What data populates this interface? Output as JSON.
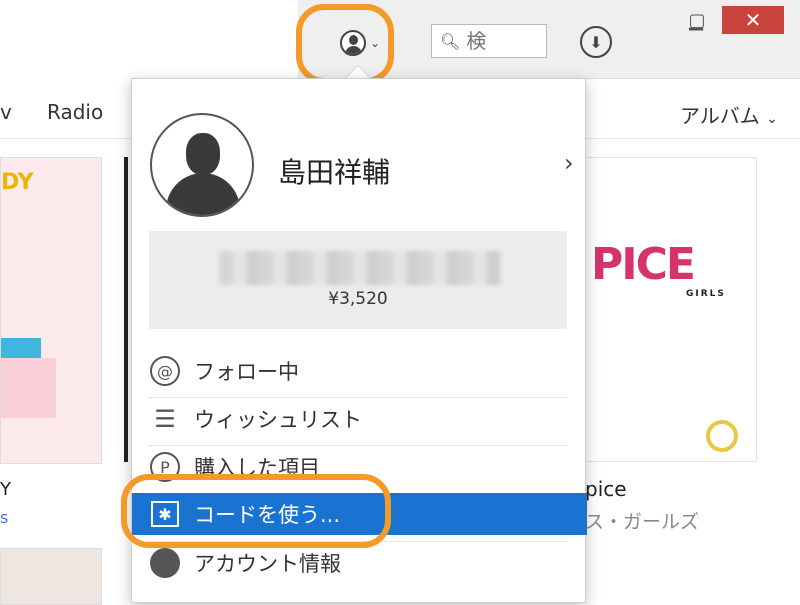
{
  "window": {
    "minimize": "▁",
    "maximize": "▢",
    "close": "✕"
  },
  "header": {
    "account_icon": "account-icon",
    "search_placeholder": "検",
    "download_icon": "download-icon"
  },
  "nav": {
    "items": [
      "v",
      "Radio"
    ],
    "right_label": "アルバム"
  },
  "background": {
    "left_card_title": "DY",
    "left_text": "Y",
    "left_blue": "s",
    "right_art_word": "PICE",
    "right_art_girls": "GIRLS",
    "right_title": "pice",
    "right_subtitle": "ス・ガールズ"
  },
  "account_menu": {
    "user_name": "島田祥輔",
    "balance": "¥3,520",
    "items": [
      {
        "label": "フォロー中",
        "icon": "at-icon",
        "glyph": "@"
      },
      {
        "label": "ウィッシュリスト",
        "icon": "list-icon",
        "glyph": "☰"
      },
      {
        "label": "購入した項目",
        "icon": "purchased-icon",
        "glyph": "P"
      },
      {
        "label": "コードを使う...",
        "icon": "gift-icon",
        "glyph": "✱",
        "selected": true
      },
      {
        "label": "アカウント情報",
        "icon": "account-info-icon",
        "glyph": "●"
      }
    ]
  },
  "colors": {
    "highlight": "#f39a2a",
    "selected": "#1a73d0",
    "close": "#c9433d"
  }
}
